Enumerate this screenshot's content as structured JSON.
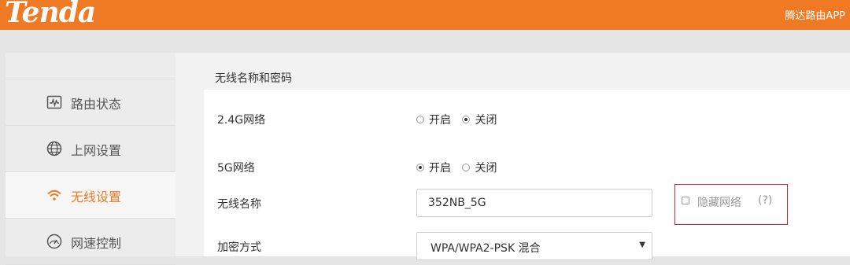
{
  "header": {
    "logo_text": "Tenda",
    "app_link": "腾达路由APP",
    "brand_color": "#f07a24"
  },
  "sidebar": {
    "items": [
      {
        "label": "路由状态",
        "icon": "pulse-monitor-icon",
        "active": false
      },
      {
        "label": "上网设置",
        "icon": "globe-icon",
        "active": false
      },
      {
        "label": "无线设置",
        "icon": "wifi-icon",
        "active": true
      },
      {
        "label": "网速控制",
        "icon": "speedometer-icon",
        "active": false
      }
    ]
  },
  "main": {
    "section_title": "无线名称和密码",
    "band24": {
      "label": "2.4G网络",
      "options": [
        "开启",
        "关闭"
      ],
      "selected": "关闭"
    },
    "band5": {
      "label": "5G网络",
      "options": [
        "开启",
        "关闭"
      ],
      "selected": "开启"
    },
    "ssid": {
      "label": "无线名称",
      "value": "352NB_5G"
    },
    "hide_network": {
      "label": "隐藏网络",
      "help": "(?)",
      "checked": false,
      "highlight_color": "#d9262b"
    },
    "encryption": {
      "label": "加密方式",
      "value": "WPA/WPA2-PSK 混合",
      "arrow": "▼"
    }
  }
}
